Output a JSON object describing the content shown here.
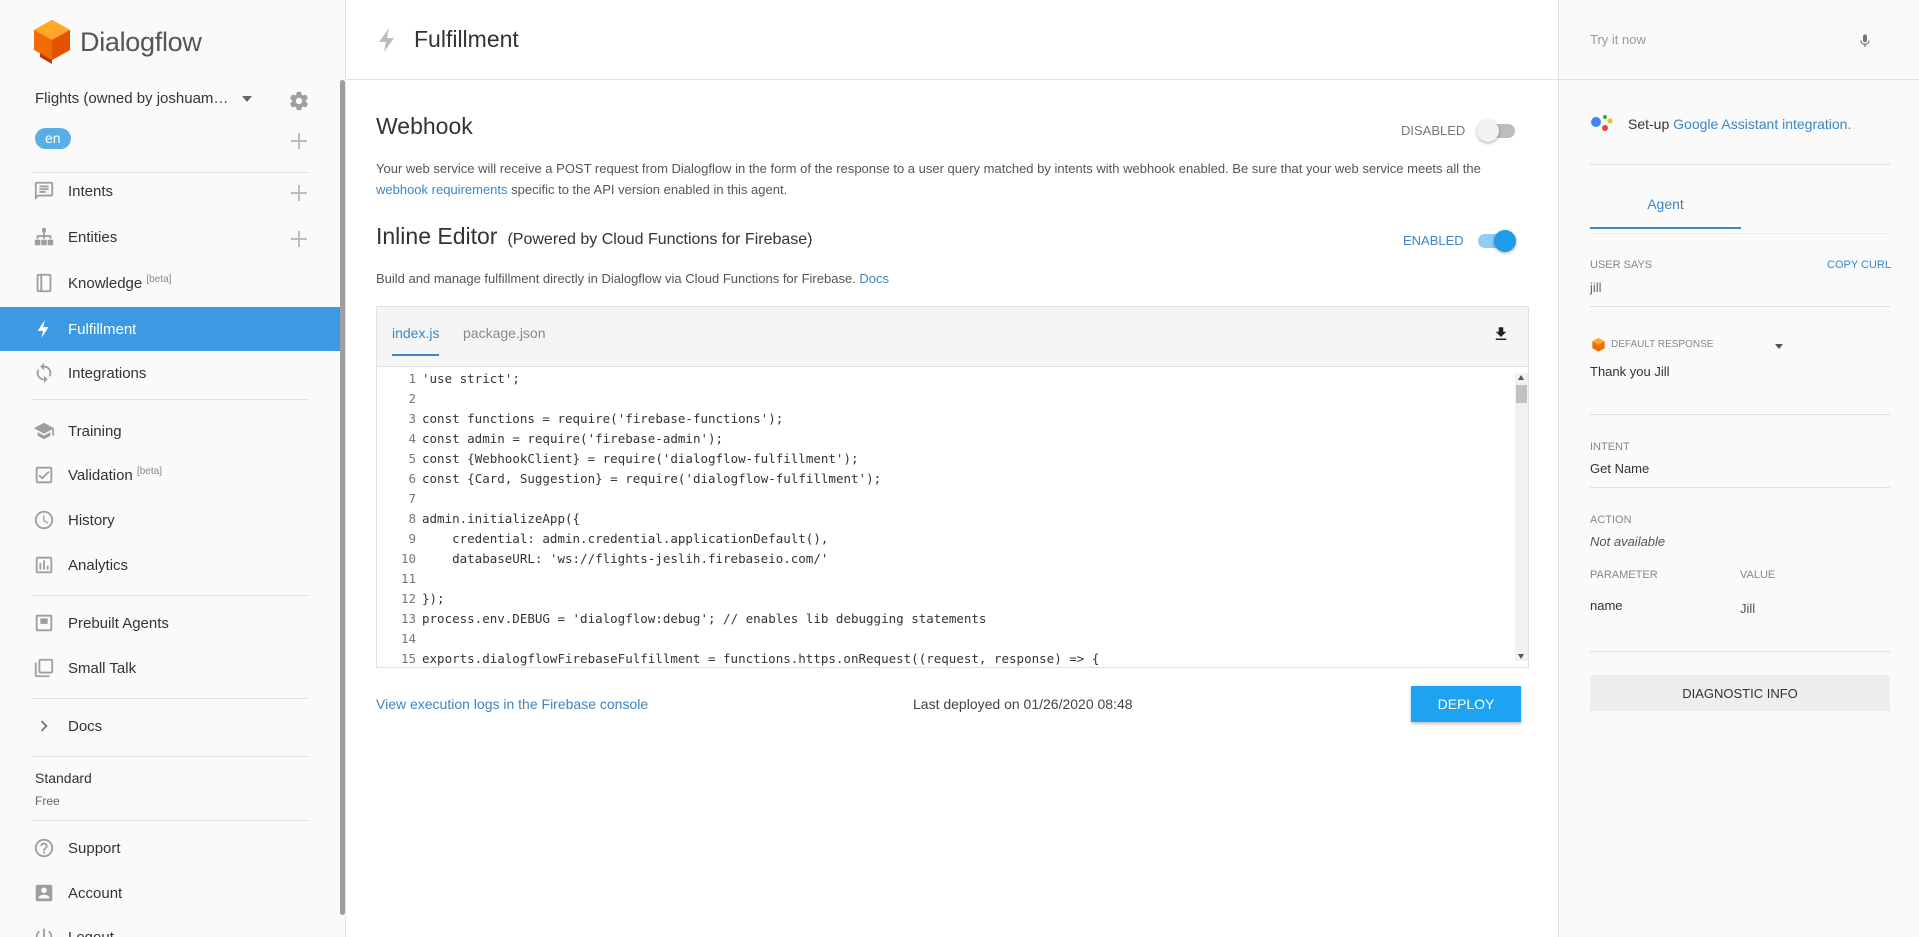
{
  "brand": {
    "name": "Dialogflow",
    "colors": {
      "orange": "#ef6c00",
      "accent": "#3b9ae1",
      "link": "#3b86c6",
      "deploy": "#1ea3f3"
    }
  },
  "sidebar": {
    "agent_name": "Flights (owned by joshuamku...",
    "language": "en",
    "items": [
      {
        "label": "Intents",
        "icon": "chat-bubble-icon"
      },
      {
        "label": "Entities",
        "icon": "hierarchy-icon"
      },
      {
        "label": "Knowledge",
        "suffix": "[beta]",
        "icon": "book-icon"
      },
      {
        "label": "Fulfillment",
        "icon": "lightning-icon",
        "active": true
      },
      {
        "label": "Integrations",
        "icon": "sync-icon"
      },
      {
        "label": "Training",
        "icon": "graduation-cap-icon"
      },
      {
        "label": "Validation",
        "suffix": "[beta]",
        "icon": "checkbox-icon"
      },
      {
        "label": "History",
        "icon": "clock-icon"
      },
      {
        "label": "Analytics",
        "icon": "bar-chart-icon"
      },
      {
        "label": "Prebuilt Agents",
        "icon": "agent-icon"
      },
      {
        "label": "Small Talk",
        "icon": "chat-stack-icon"
      },
      {
        "label": "Docs",
        "icon": "chevron-right-icon"
      },
      {
        "label": "Support",
        "icon": "help-icon"
      },
      {
        "label": "Account",
        "icon": "account-icon"
      },
      {
        "label": "Logout",
        "icon": "power-icon"
      }
    ],
    "plan": {
      "name": "Standard",
      "tier": "Free"
    }
  },
  "header": {
    "title": "Fulfillment"
  },
  "webhook": {
    "title": "Webhook",
    "status": "DISABLED",
    "desc_before": "Your web service will receive a POST request from Dialogflow in the form of the response to a user query matched by intents with webhook enabled. Be sure that your web service meets all the ",
    "desc_link": "webhook requirements",
    "desc_after": " specific to the API version enabled in this agent."
  },
  "inline_editor": {
    "title": "Inline Editor",
    "subtitle": "(Powered by Cloud Functions for Firebase)",
    "status": "ENABLED",
    "desc": "Build and manage fulfillment directly in Dialogflow via Cloud Functions for Firebase. ",
    "docs_link": "Docs",
    "tabs": [
      "index.js",
      "package.json"
    ],
    "code_lines": [
      {
        "n": "1",
        "parts": [
          {
            "t": "'use strict'",
            "c": "str"
          },
          {
            "t": ";",
            "c": ""
          }
        ]
      },
      {
        "n": "2",
        "parts": []
      },
      {
        "n": "3",
        "parts": [
          {
            "t": "const ",
            "c": ""
          },
          {
            "t": "functions",
            "c": "var"
          },
          {
            "t": " = require(",
            "c": ""
          },
          {
            "t": "'firebase-functions'",
            "c": "str"
          },
          {
            "t": ");",
            "c": ""
          }
        ]
      },
      {
        "n": "4",
        "parts": [
          {
            "t": "const ",
            "c": ""
          },
          {
            "t": "admin",
            "c": "var"
          },
          {
            "t": " = require(",
            "c": ""
          },
          {
            "t": "'firebase-admin'",
            "c": "str"
          },
          {
            "t": ");",
            "c": ""
          }
        ]
      },
      {
        "n": "5",
        "parts": [
          {
            "t": "const {",
            "c": ""
          },
          {
            "t": "WebhookClient",
            "c": "var"
          },
          {
            "t": "} = require(",
            "c": ""
          },
          {
            "t": "'dialogflow-fulfillment'",
            "c": "str"
          },
          {
            "t": ");",
            "c": ""
          }
        ]
      },
      {
        "n": "6",
        "parts": [
          {
            "t": "const {",
            "c": ""
          },
          {
            "t": "Card",
            "c": "var"
          },
          {
            "t": ", ",
            "c": ""
          },
          {
            "t": "Suggestion",
            "c": "var"
          },
          {
            "t": "} = require(",
            "c": ""
          },
          {
            "t": "'dialogflow-fulfillment'",
            "c": "str"
          },
          {
            "t": ");",
            "c": ""
          }
        ]
      },
      {
        "n": "7",
        "parts": []
      },
      {
        "n": "8",
        "parts": [
          {
            "t": "admin.initializeApp({",
            "c": ""
          }
        ]
      },
      {
        "n": "9",
        "parts": [
          {
            "t": "    credential: admin.credential.applicationDefault(),",
            "c": ""
          }
        ]
      },
      {
        "n": "10",
        "parts": [
          {
            "t": "    databaseURL: ",
            "c": ""
          },
          {
            "t": "'ws://flights-jeslih.firebaseio.com/'",
            "c": "str"
          }
        ]
      },
      {
        "n": "11",
        "parts": []
      },
      {
        "n": "12",
        "parts": [
          {
            "t": "});",
            "c": ""
          }
        ]
      },
      {
        "n": "13",
        "parts": [
          {
            "t": "process.env.DEBUG = ",
            "c": ""
          },
          {
            "t": "'dialogflow:debug'",
            "c": "str"
          },
          {
            "t": "; ",
            "c": ""
          },
          {
            "t": "// enables lib debugging statements",
            "c": "cmt"
          }
        ]
      },
      {
        "n": "14",
        "parts": []
      },
      {
        "n": "15",
        "parts": [
          {
            "t": "exports.dialogflowFirebaseFulfillment = functions.https.onRequest((",
            "c": ""
          },
          {
            "t": "request",
            "c": "var"
          },
          {
            "t": ", ",
            "c": ""
          },
          {
            "t": "response",
            "c": "var"
          },
          {
            "t": ") => {",
            "c": ""
          }
        ]
      }
    ],
    "logs_link": "View execution logs in the Firebase console",
    "last_deployed": "Last deployed on 01/26/2020 08:48",
    "deploy_label": "DEPLOY"
  },
  "right_panel": {
    "try_placeholder": "Try it now",
    "ga_text": "Set-up ",
    "ga_link": "Google Assistant integration.",
    "tab": "Agent",
    "user_says_label": "USER SAYS",
    "copy_curl": "COPY CURL",
    "user_says_value": "jill",
    "default_response_label": "DEFAULT RESPONSE",
    "response_value": "Thank you Jill",
    "intent_label": "INTENT",
    "intent_value": "Get Name",
    "action_label": "ACTION",
    "action_value": "Not available",
    "parameter_label": "PARAMETER",
    "value_label": "VALUE",
    "param_name": "name",
    "param_value": "Jill",
    "diagnostic_label": "DIAGNOSTIC INFO"
  }
}
